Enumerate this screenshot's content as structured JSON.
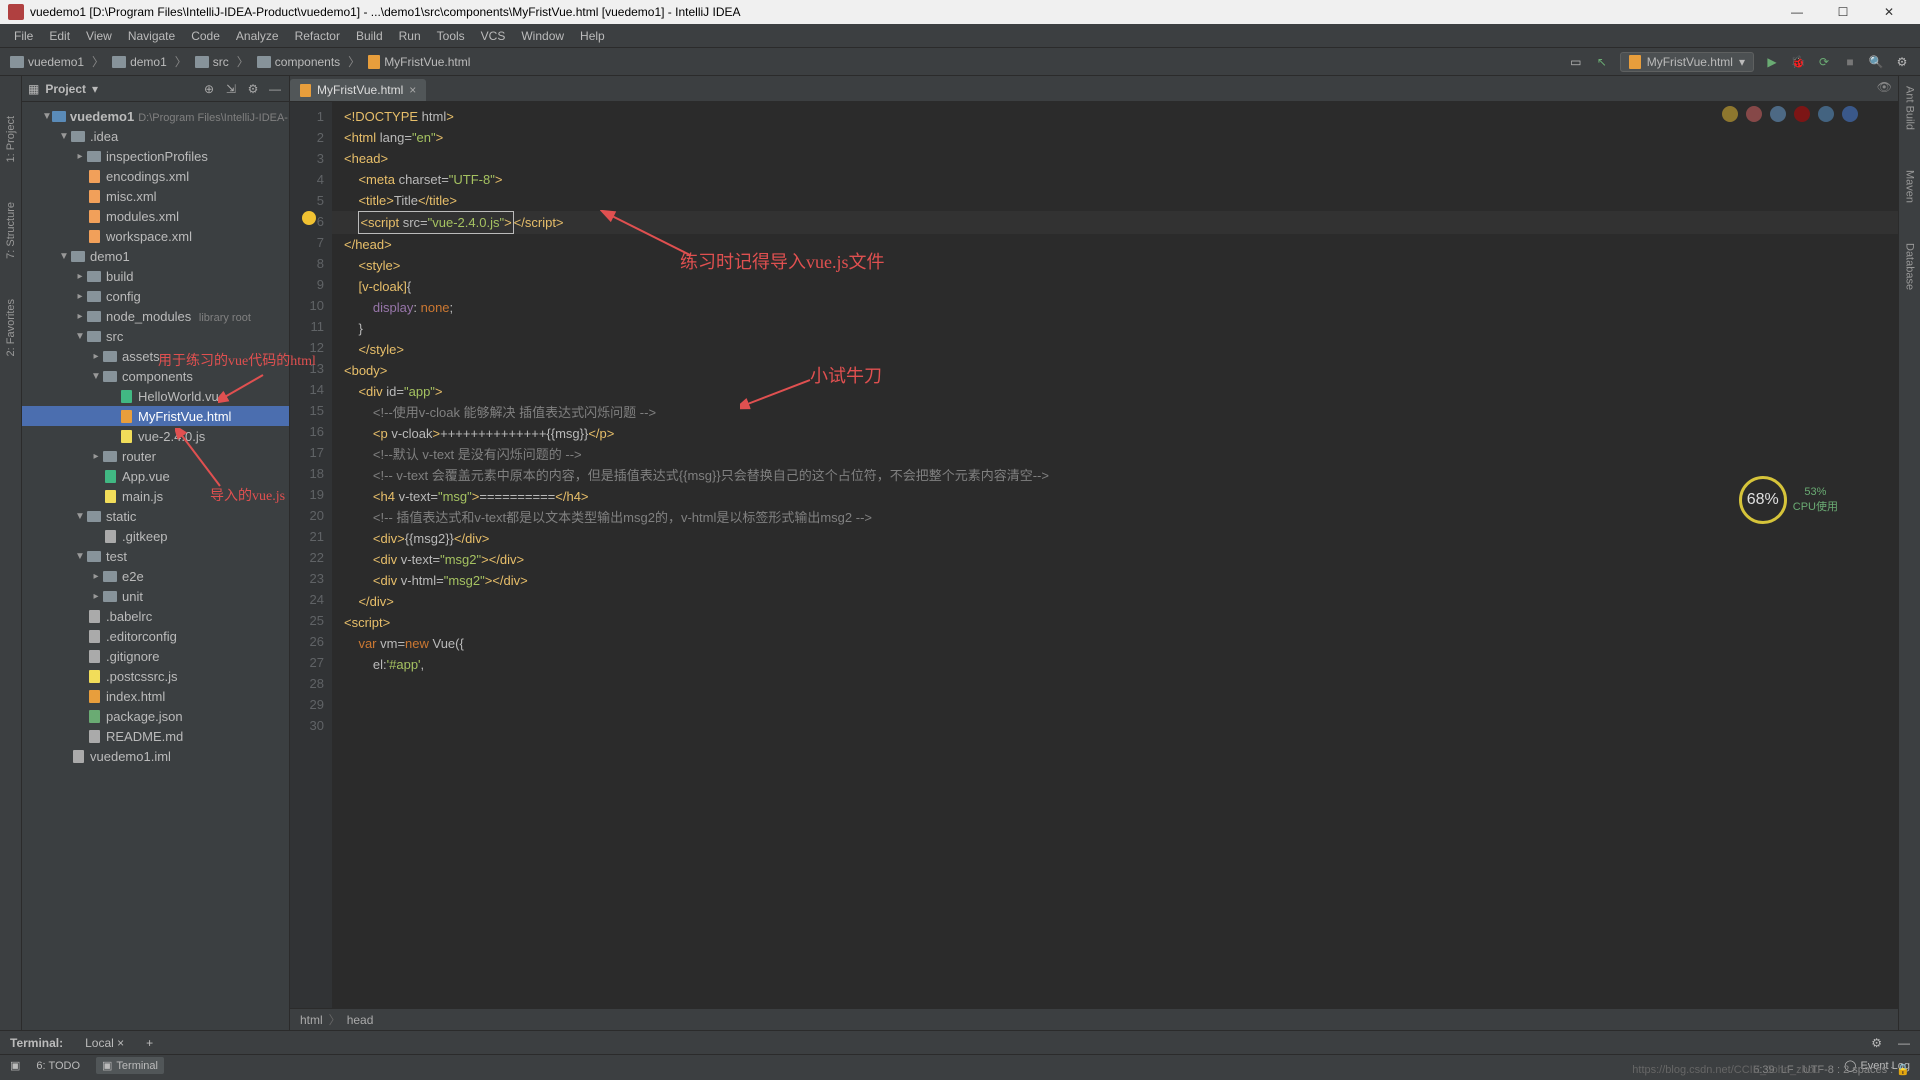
{
  "titlebar": {
    "text": "vuedemo1 [D:\\Program Files\\IntelliJ-IDEA-Product\\vuedemo1] - ...\\demo1\\src\\components\\MyFristVue.html [vuedemo1] - IntelliJ IDEA"
  },
  "menu": [
    "File",
    "Edit",
    "View",
    "Navigate",
    "Code",
    "Analyze",
    "Refactor",
    "Build",
    "Run",
    "Tools",
    "VCS",
    "Window",
    "Help"
  ],
  "nav_crumbs": [
    "vuedemo1",
    "demo1",
    "src",
    "components",
    "MyFristVue.html"
  ],
  "run_config": "MyFristVue.html",
  "project": {
    "title": "Project",
    "root": "vuedemo1",
    "root_hint": "D:\\Program Files\\IntelliJ-IDEA-...",
    "idea": ".idea",
    "inspection": "inspectionProfiles",
    "encodings": "encodings.xml",
    "misc": "misc.xml",
    "modules": "modules.xml",
    "workspace": "workspace.xml",
    "demo1": "demo1",
    "build": "build",
    "config": "config",
    "node_modules": "node_modules",
    "nm_hint": "library root",
    "src": "src",
    "assets": "assets",
    "components": "components",
    "hello": "HelloWorld.vue",
    "myfrist": "MyFristVue.html",
    "vuejs": "vue-2.4.0.js",
    "router": "router",
    "appvue": "App.vue",
    "mainjs": "main.js",
    "static": "static",
    "gitkeep": ".gitkeep",
    "test": "test",
    "e2e": "e2e",
    "unit": "unit",
    "babelrc": ".babelrc",
    "editorconfig": ".editorconfig",
    "gitignore": ".gitignore",
    "postcss": ".postcssrc.js",
    "indexhtml": "index.html",
    "packagejson": "package.json",
    "readme": "README.md",
    "iml": "vuedemo1.iml"
  },
  "tab": {
    "name": "MyFristVue.html"
  },
  "code": [
    {
      "n": "1",
      "html": "<span class='tag'>&lt;!DOCTYPE </span><span class='attr'>html</span><span class='tag'>&gt;</span>"
    },
    {
      "n": "2",
      "html": "<span class='tag'>&lt;html </span><span class='attr'>lang=</span><span class='str'>\"en\"</span><span class='tag'>&gt;</span>"
    },
    {
      "n": "3",
      "html": "<span class='tag'>&lt;head&gt;</span>"
    },
    {
      "n": "4",
      "html": "    <span class='tag'>&lt;meta </span><span class='attr'>charset=</span><span class='str'>\"UTF-8\"</span><span class='tag'>&gt;</span>"
    },
    {
      "n": "5",
      "html": "    <span class='tag'>&lt;title&gt;</span><span class='txt'>Title</span><span class='tag'>&lt;/title&gt;</span>",
      "bulb": true
    },
    {
      "n": "6",
      "html": "    <span class='cursor-box'><span class='tag'>&lt;script </span><span class='attr'>src=</span><span class='str'>\"vue-2.4.0.js\"</span><span class='tag'>&gt;</span></span><span class='tag'>&lt;/script&gt;</span>",
      "caret": true
    },
    {
      "n": "7",
      "html": "<span class='tag'>&lt;/head&gt;</span>"
    },
    {
      "n": "8",
      "html": "    <span class='tag'>&lt;style&gt;</span>"
    },
    {
      "n": "9",
      "html": "    <span class='sel'>[v-cloak]</span><span class='txt'>{</span>"
    },
    {
      "n": "10",
      "html": "        <span class='prop'>display</span><span class='txt'>: </span><span class='kw'>none</span><span class='txt'>;</span>"
    },
    {
      "n": "11",
      "html": "    <span class='txt'>}</span>"
    },
    {
      "n": "12",
      "html": "    <span class='tag'>&lt;/style&gt;</span>"
    },
    {
      "n": "13",
      "html": "<span class='tag'>&lt;body&gt;</span>"
    },
    {
      "n": "14",
      "html": "    <span class='tag'>&lt;div </span><span class='attr'>id=</span><span class='str'>\"app\"</span><span class='tag'>&gt;</span>"
    },
    {
      "n": "15",
      "html": "        <span class='cmt'>&lt;!--使用v-cloak 能够解决 插值表达式闪烁问题 --&gt;</span>"
    },
    {
      "n": "16",
      "html": "        <span class='tag'>&lt;p </span><span class='attr'>v-cloak</span><span class='tag'>&gt;</span><span class='txt'>++++++++++++++{{msg}}</span><span class='tag'>&lt;/p&gt;</span>"
    },
    {
      "n": "17",
      "html": "        <span class='cmt'>&lt;!--默认 v-text 是没有闪烁问题的 --&gt;</span>"
    },
    {
      "n": "18",
      "html": "        <span class='cmt'>&lt;!-- v-text 会覆盖元素中原本的内容，但是插值表达式{{msg}}只会替换自己的这个占位符，不会把整个元素内容清空--&gt;</span>"
    },
    {
      "n": "19",
      "html": "        <span class='tag'>&lt;h4 </span><span class='attr'>v-text=</span><span class='str'>\"msg\"</span><span class='tag'>&gt;</span><span class='txt'>==========</span><span class='tag'>&lt;/h4&gt;</span>"
    },
    {
      "n": "20",
      "html": ""
    },
    {
      "n": "21",
      "html": "        <span class='cmt'>&lt;!-- 插值表达式和v-text都是以文本类型输出msg2的，v-html是以标签形式输出msg2 --&gt;</span>"
    },
    {
      "n": "22",
      "html": "        <span class='tag'>&lt;div&gt;</span><span class='txt'>{{msg2}}</span><span class='tag'>&lt;/div&gt;</span>"
    },
    {
      "n": "23",
      "html": "        <span class='tag'>&lt;div </span><span class='attr'>v-text=</span><span class='str'>\"msg2\"</span><span class='tag'>&gt;&lt;/div&gt;</span>"
    },
    {
      "n": "24",
      "html": "        <span class='tag'>&lt;div </span><span class='attr'>v-html=</span><span class='str'>\"msg2\"</span><span class='tag'>&gt;&lt;/div&gt;</span>"
    },
    {
      "n": "25",
      "html": "    <span class='tag'>&lt;/div&gt;</span>"
    },
    {
      "n": "26",
      "html": ""
    },
    {
      "n": "27",
      "html": ""
    },
    {
      "n": "28",
      "html": "<span class='tag'>&lt;script&gt;</span>"
    },
    {
      "n": "29",
      "html": "    <span class='kw'>var </span><span class='txt'>vm=</span><span class='kw'>new </span><span class='txt'>Vue({</span>"
    },
    {
      "n": "30",
      "html": "        <span class='txt'>el:</span><span class='str'>'#app'</span><span class='txt'>,</span>"
    }
  ],
  "breadcrumbs": [
    "html",
    "head"
  ],
  "terminal": {
    "label": "Terminal:",
    "tab": "Local",
    "plus": "+"
  },
  "bottom": {
    "todo": "6: TODO",
    "terminal": "Terminal",
    "eventlog": "Event Log"
  },
  "status": {
    "pos": "6:39",
    "enc": "LF : UTF-8 : 2 spaces :"
  },
  "left_tabs": [
    "1: Project",
    "2: Favorites",
    "7: Structure"
  ],
  "right_tabs": [
    "Ant Build",
    "Maven",
    "Database"
  ],
  "cpu": {
    "pct": "68%",
    "label": "53%\nCPU使用"
  },
  "annotations": {
    "a1": "练习时记得导入vue.js文件",
    "a2": "小试牛刀",
    "a3": "用于练习的vue代码的html",
    "a4": "导入的vue.js"
  },
  "watermark": "https://blog.csdn.net/CCIE_John_zhou"
}
